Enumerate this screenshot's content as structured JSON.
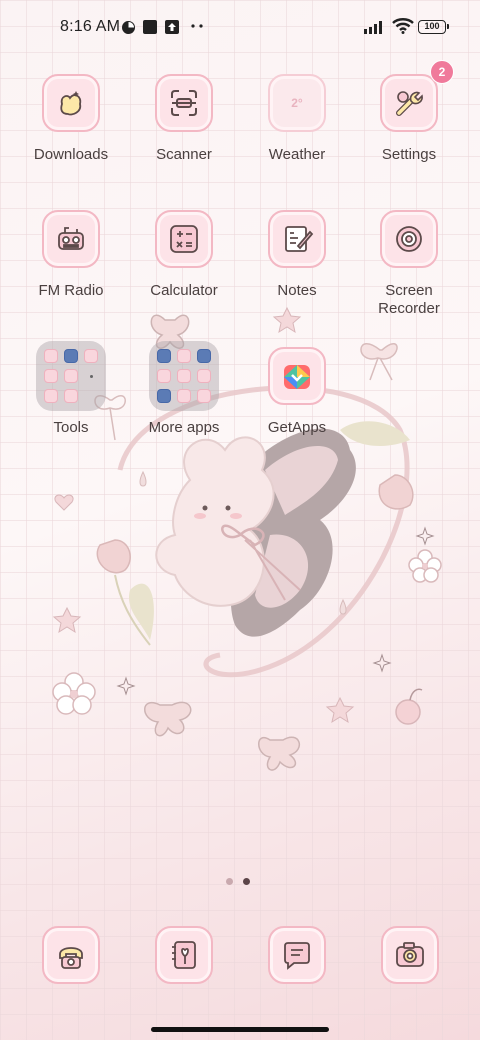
{
  "status_bar": {
    "time": "8:16 AM",
    "battery": "100",
    "icons": [
      "data-saver-icon",
      "square-notification-icon",
      "upload-icon",
      "more-dots-icon",
      "signal-icon",
      "wifi-icon",
      "battery-icon"
    ]
  },
  "apps": {
    "downloads": "Downloads",
    "scanner": "Scanner",
    "weather": "Weather",
    "settings": "Settings",
    "settings_badge": "2",
    "fm_radio": "FM Radio",
    "calculator": "Calculator",
    "notes": "Notes",
    "screen_recorder": "Screen Recorder",
    "tools": "Tools",
    "more_apps": "More apps",
    "getapps": "GetApps"
  },
  "pager": {
    "pages": 2,
    "current": 2
  },
  "dock": {
    "items": [
      "phone-icon",
      "contacts-icon",
      "messages-icon",
      "camera-icon"
    ]
  },
  "colors": {
    "tile_bg": "#fde3e8",
    "tile_border": "#f3b8c4",
    "badge": "#f07a9b",
    "label": "#4a4040"
  }
}
